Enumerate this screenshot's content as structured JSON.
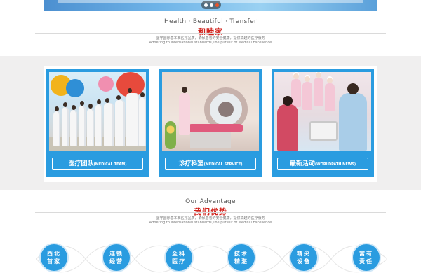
{
  "hero": {
    "dots": 3,
    "active_dot": 2
  },
  "section1": {
    "title_en": "Health · Beautiful · Transfer",
    "title_cn": "和睦家",
    "desc_cn": "坚守国际基本准医疗品质，确保患者的安全健康，提供卓越的医疗服务",
    "desc_en": "Adhering to international standards,The pursuit of Medical Excellence"
  },
  "cards": [
    {
      "label_cn": "医疗团队",
      "label_en": "(MEDICAL TEAM)"
    },
    {
      "label_cn": "诊疗科室",
      "label_en": "(MEDICAL SERVICE)"
    },
    {
      "label_cn": "最新活动",
      "label_en": "(WORLDPATH NEWS)"
    }
  ],
  "section2": {
    "title_en": "Our Advantage",
    "title_cn": "我们优势",
    "desc_cn": "坚守国际基本准医疗品质，确保患者的安全健康，提供卓越的医疗服务",
    "desc_en": "Adhering to international standards,The pursuit of Medical Excellence"
  },
  "advantages": [
    {
      "label": "西北首家"
    },
    {
      "label": "连锁经营"
    },
    {
      "label": "全科医疗"
    },
    {
      "label": "技术精湛"
    },
    {
      "label": "精尖设备"
    },
    {
      "label": "富有责任"
    }
  ],
  "colors": {
    "accent_blue": "#2a9ce0",
    "title_red": "#d0201a",
    "band_gray": "#f0efef"
  }
}
